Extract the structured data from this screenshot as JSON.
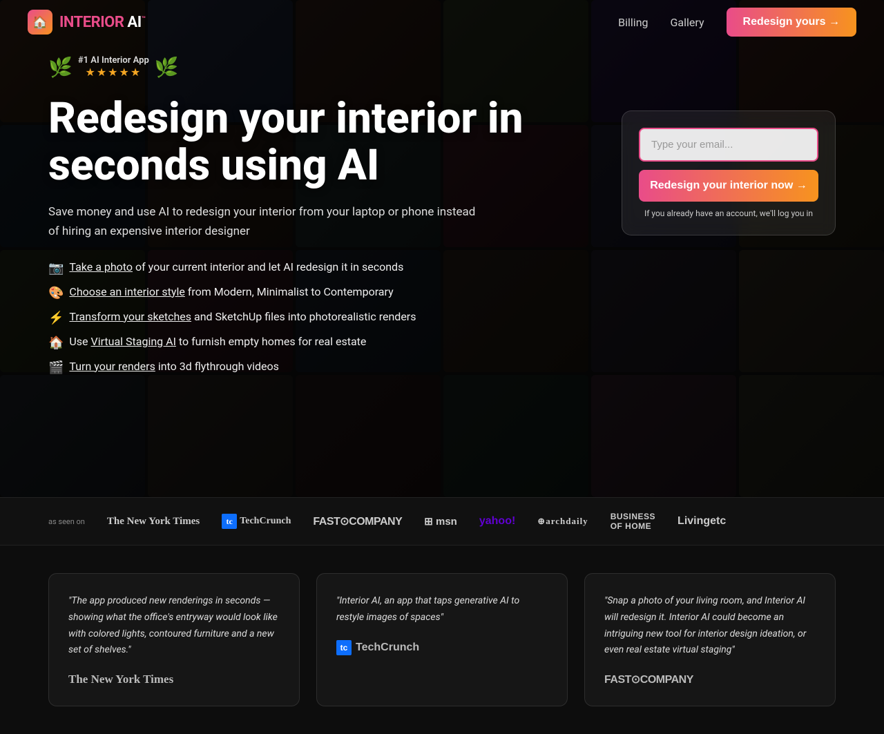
{
  "nav": {
    "logo_text": "INTERIOR AI",
    "logo_tm": "™",
    "billing_label": "Billing",
    "gallery_label": "Gallery",
    "cta_label": "Redesign yours →"
  },
  "hero": {
    "award_title": "#1 AI Interior App",
    "stars": "★★★★★",
    "headline": "Redesign your interior in seconds using AI",
    "subtext": "Save money and use AI to redesign your interior from your laptop or phone instead of hiring an expensive interior designer",
    "features": [
      {
        "emoji": "📷",
        "text_before": "",
        "link": "Take a photo",
        "text_after": " of your current interior and let AI redesign it in seconds"
      },
      {
        "emoji": "🎨",
        "text_before": "",
        "link": "Choose an interior style",
        "text_after": " from Modern, Minimalist to Contemporary"
      },
      {
        "emoji": "⚡",
        "text_before": "",
        "link": "Transform your sketches",
        "text_after": " and SketchUp files into photorealistic renders"
      },
      {
        "emoji": "🏠",
        "text_before": "Use ",
        "link": "Virtual Staging AI",
        "text_after": " to furnish empty homes for real estate"
      },
      {
        "emoji": "🎬",
        "text_before": "",
        "link": "Turn your renders",
        "text_after": " into 3d flythrough videos"
      }
    ],
    "email_placeholder": "Type your email...",
    "cta_button": "Redesign your interior now →",
    "form_note": "If you already have an account, we'll log you in"
  },
  "press": {
    "as_seen_on": "as seen on",
    "logos": [
      {
        "name": "The New York Times",
        "style": "serif"
      },
      {
        "name": "TechCrunch",
        "style": "tech"
      },
      {
        "name": "Fast Company",
        "style": "fast"
      },
      {
        "name": "msn",
        "style": "msn"
      },
      {
        "name": "yahoo! news",
        "style": "yahoo"
      },
      {
        "name": "archdaily",
        "style": "arch"
      },
      {
        "name": "Business of Home",
        "style": "boh"
      },
      {
        "name": "Livingetc",
        "style": "living"
      }
    ]
  },
  "testimonials": [
    {
      "text": "\"The app produced new renderings in seconds — showing what the office's entryway would look like with colored lights, contoured furniture and a new set of shelves.\"",
      "logo": "The New York Times",
      "logo_style": "serif"
    },
    {
      "text": "\"Interior AI, an app that taps generative AI to restyle images of spaces\"",
      "logo": "TechCrunch",
      "logo_style": "tech"
    },
    {
      "text": "\"Snap a photo of your living room, and Interior AI will redesign it. Interior AI could become an intriguing new tool for interior design ideation, or even real estate virtual staging\"",
      "logo": "Fast Company",
      "logo_style": "fast"
    }
  ],
  "colors": {
    "accent_pink": "#e94c89",
    "accent_orange": "#f7931e"
  }
}
